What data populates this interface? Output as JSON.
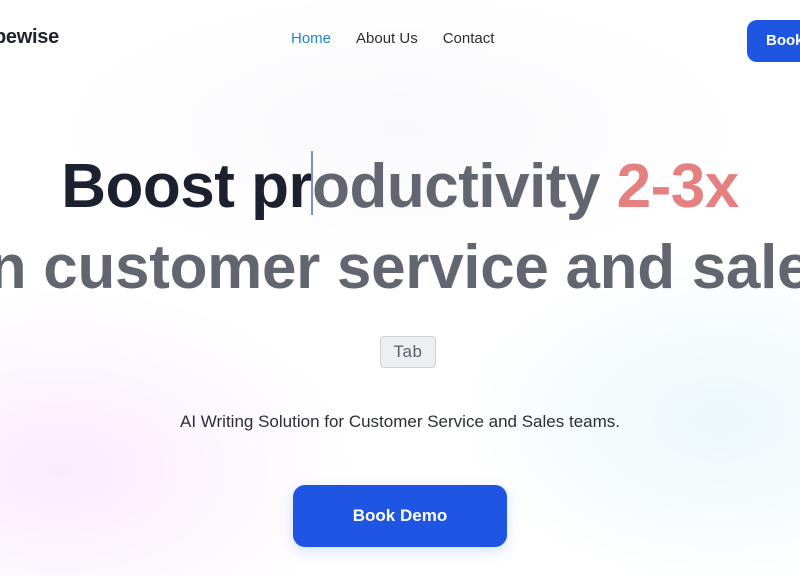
{
  "header": {
    "logo_text": "pewise",
    "nav": [
      {
        "label": "Home",
        "active": true
      },
      {
        "label": "About Us",
        "active": false
      },
      {
        "label": "Contact",
        "active": false
      }
    ],
    "cta_label": "Book"
  },
  "hero": {
    "headline_typed": "Boost pr",
    "headline_ghost": "oductivity ",
    "headline_accent": "2-3x",
    "headline_line2": "n customer service and sale",
    "tab_key_label": "Tab",
    "subtitle": "AI Writing Solution for Customer Service and Sales teams.",
    "cta_label": "Book Demo"
  },
  "colors": {
    "primary": "#1e55e3",
    "nav_active": "#1f86c6",
    "accent": "#e68080",
    "ghost_text": "#626670",
    "dark_text": "#1c2130"
  }
}
